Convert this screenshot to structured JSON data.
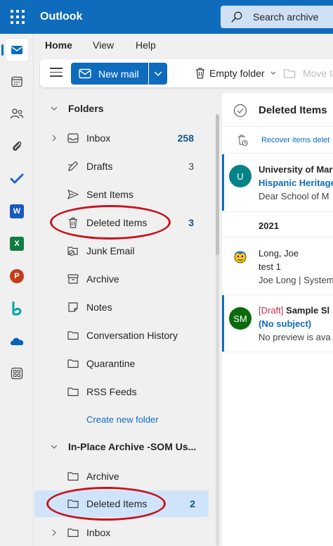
{
  "header": {
    "app_name": "Outlook",
    "search_placeholder": "Search archive"
  },
  "rail": {
    "items": [
      {
        "name": "mail-icon",
        "active": true
      },
      {
        "name": "calendar-icon"
      },
      {
        "name": "people-icon"
      },
      {
        "name": "attachment-icon"
      },
      {
        "name": "todo-icon"
      },
      {
        "name": "word-icon",
        "letter": "W",
        "color": "#185abd"
      },
      {
        "name": "excel-icon",
        "letter": "X",
        "color": "#107c41"
      },
      {
        "name": "powerpoint-icon",
        "letter": "P",
        "color": "#c43e1c"
      },
      {
        "name": "bookings-icon"
      },
      {
        "name": "onedrive-icon"
      },
      {
        "name": "more-apps-icon"
      }
    ]
  },
  "ribbon": {
    "tabs": [
      "Home",
      "View",
      "Help"
    ],
    "new_mail": "New mail",
    "empty_folder": "Empty folder",
    "move_to": "Move to"
  },
  "folders": {
    "section_label": "Folders",
    "inbox": {
      "label": "Inbox",
      "count": "258"
    },
    "drafts": {
      "label": "Drafts",
      "count": "3"
    },
    "sent": {
      "label": "Sent Items"
    },
    "deleted": {
      "label": "Deleted Items",
      "count": "3"
    },
    "junk": {
      "label": "Junk Email"
    },
    "archive": {
      "label": "Archive"
    },
    "notes": {
      "label": "Notes"
    },
    "conversation": {
      "label": "Conversation History"
    },
    "quarantine": {
      "label": "Quarantine"
    },
    "rss": {
      "label": "RSS Feeds"
    },
    "create_new": "Create new folder",
    "archive_section_label": "In-Place Archive -SOM Us...",
    "archive_archive": {
      "label": "Archive"
    },
    "archive_deleted": {
      "label": "Deleted Items",
      "count": "2"
    },
    "archive_inbox": {
      "label": "Inbox"
    }
  },
  "message_list": {
    "title": "Deleted Items",
    "recover_text": "Recover items delet",
    "group_2021": "2021",
    "messages": [
      {
        "initials": "U",
        "avatar_color": "#038387",
        "sender": "University of Mar",
        "subject": "Hispanic Heritage",
        "preview": "Dear School of M"
      },
      {
        "sender": "Long, Joe",
        "subject": "test 1",
        "preview": "Joe Long | System"
      },
      {
        "initials": "SM",
        "avatar_color": "#0b6a0b",
        "draft_tag": "[Draft]",
        "sender": "Sample Sl",
        "subject": "(No subject)",
        "preview": "No preview is ava"
      }
    ]
  }
}
